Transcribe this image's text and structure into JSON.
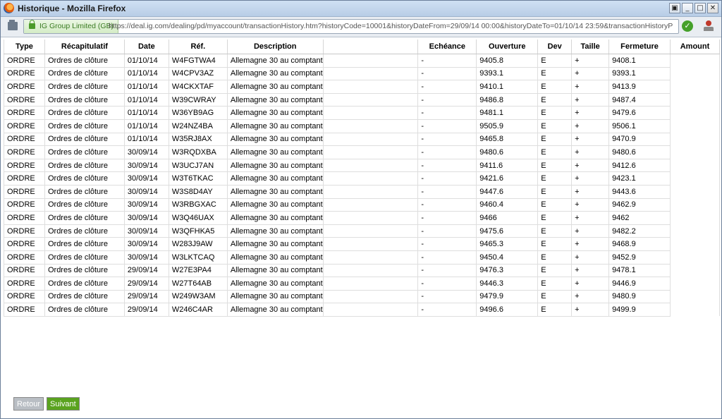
{
  "window": {
    "title": "Historique - Mozilla Firefox",
    "controls": [
      "▣",
      "_",
      "□",
      "✕"
    ]
  },
  "urlbar": {
    "identity": "IG Group Limited (GB)",
    "url": "https://deal.ig.com/dealing/pd/myaccount/transactionHistory.htm?historyCode=10001&historyDateFrom=29/09/14 00:00&historyDateTo=01/10/14 23:59&transactionHistoryPageNumber="
  },
  "table": {
    "headers": [
      "Type",
      "Récapitulatif",
      "Date",
      "Réf.",
      "Description",
      "",
      "Echéance",
      "Ouverture",
      "Dev",
      "Taille",
      "Fermeture",
      "Amount"
    ],
    "rows": [
      [
        "ORDRE",
        "Ordres de clôture",
        "01/10/14",
        "W4FGTWA4",
        "Allemagne 30 au comptant",
        "",
        "-",
        "9405.8",
        "E",
        "+",
        "9408.1",
        ""
      ],
      [
        "ORDRE",
        "Ordres de clôture",
        "01/10/14",
        "W4CPV3AZ",
        "Allemagne 30 au comptant",
        "",
        "-",
        "9393.1",
        "E",
        "+",
        "9393.1",
        ""
      ],
      [
        "ORDRE",
        "Ordres de clôture",
        "01/10/14",
        "W4CKXTAF",
        "Allemagne 30 au comptant",
        "",
        "-",
        "9410.1",
        "E",
        "+",
        "9413.9",
        ""
      ],
      [
        "ORDRE",
        "Ordres de clôture",
        "01/10/14",
        "W39CWRAY",
        "Allemagne 30 au comptant",
        "",
        "-",
        "9486.8",
        "E",
        "+",
        "9487.4",
        ""
      ],
      [
        "ORDRE",
        "Ordres de clôture",
        "01/10/14",
        "W36YB9AG",
        "Allemagne 30 au comptant",
        "",
        "-",
        "9481.1",
        "E",
        "+",
        "9479.6",
        ""
      ],
      [
        "ORDRE",
        "Ordres de clôture",
        "01/10/14",
        "W24NZ4BA",
        "Allemagne 30 au comptant",
        "",
        "-",
        "9505.9",
        "E",
        "+",
        "9506.1",
        ""
      ],
      [
        "ORDRE",
        "Ordres de clôture",
        "01/10/14",
        "W35RJ8AX",
        "Allemagne 30 au comptant",
        "",
        "-",
        "9465.8",
        "E",
        "+",
        "9470.9",
        ""
      ],
      [
        "ORDRE",
        "Ordres de clôture",
        "30/09/14",
        "W3RQDXBA",
        "Allemagne 30 au comptant",
        "",
        "-",
        "9480.6",
        "E",
        "+",
        "9480.6",
        ""
      ],
      [
        "ORDRE",
        "Ordres de clôture",
        "30/09/14",
        "W3UCJ7AN",
        "Allemagne 30 au comptant",
        "",
        "-",
        "9411.6",
        "E",
        "+",
        "9412.6",
        ""
      ],
      [
        "ORDRE",
        "Ordres de clôture",
        "30/09/14",
        "W3T6TKAC",
        "Allemagne 30 au comptant",
        "",
        "-",
        "9421.6",
        "E",
        "+",
        "9423.1",
        ""
      ],
      [
        "ORDRE",
        "Ordres de clôture",
        "30/09/14",
        "W3S8D4AY",
        "Allemagne 30 au comptant",
        "",
        "-",
        "9447.6",
        "E",
        "+",
        "9443.6",
        ""
      ],
      [
        "ORDRE",
        "Ordres de clôture",
        "30/09/14",
        "W3RBGXAC",
        "Allemagne 30 au comptant",
        "",
        "-",
        "9460.4",
        "E",
        "+",
        "9462.9",
        ""
      ],
      [
        "ORDRE",
        "Ordres de clôture",
        "30/09/14",
        "W3Q46UAX",
        "Allemagne 30 au comptant",
        "",
        "-",
        "9466",
        "E",
        "+",
        "9462",
        ""
      ],
      [
        "ORDRE",
        "Ordres de clôture",
        "30/09/14",
        "W3QFHKA5",
        "Allemagne 30 au comptant",
        "",
        "-",
        "9475.6",
        "E",
        "+",
        "9482.2",
        ""
      ],
      [
        "ORDRE",
        "Ordres de clôture",
        "30/09/14",
        "W283J9AW",
        "Allemagne 30 au comptant",
        "",
        "-",
        "9465.3",
        "E",
        "+",
        "9468.9",
        ""
      ],
      [
        "ORDRE",
        "Ordres de clôture",
        "30/09/14",
        "W3LKTCAQ",
        "Allemagne 30 au comptant",
        "",
        "-",
        "9450.4",
        "E",
        "+",
        "9452.9",
        ""
      ],
      [
        "ORDRE",
        "Ordres de clôture",
        "29/09/14",
        "W27E3PA4",
        "Allemagne 30 au comptant",
        "",
        "-",
        "9476.3",
        "E",
        "+",
        "9478.1",
        ""
      ],
      [
        "ORDRE",
        "Ordres de clôture",
        "29/09/14",
        "W27T64AB",
        "Allemagne 30 au comptant",
        "",
        "-",
        "9446.3",
        "E",
        "+",
        "9446.9",
        ""
      ],
      [
        "ORDRE",
        "Ordres de clôture",
        "29/09/14",
        "W249W3AM",
        "Allemagne 30 au comptant",
        "",
        "-",
        "9479.9",
        "E",
        "+",
        "9480.9",
        ""
      ],
      [
        "ORDRE",
        "Ordres de clôture",
        "29/09/14",
        "W246C4AR",
        "Allemagne 30 au comptant",
        "",
        "-",
        "9496.6",
        "E",
        "+",
        "9499.9",
        ""
      ]
    ]
  },
  "pager": {
    "prev_label": "Retour",
    "next_label": "Suivant"
  },
  "colors": {
    "next_button": "#5aa31f",
    "prev_button": "#b9bec4",
    "identity_green": "#3a7a22"
  }
}
